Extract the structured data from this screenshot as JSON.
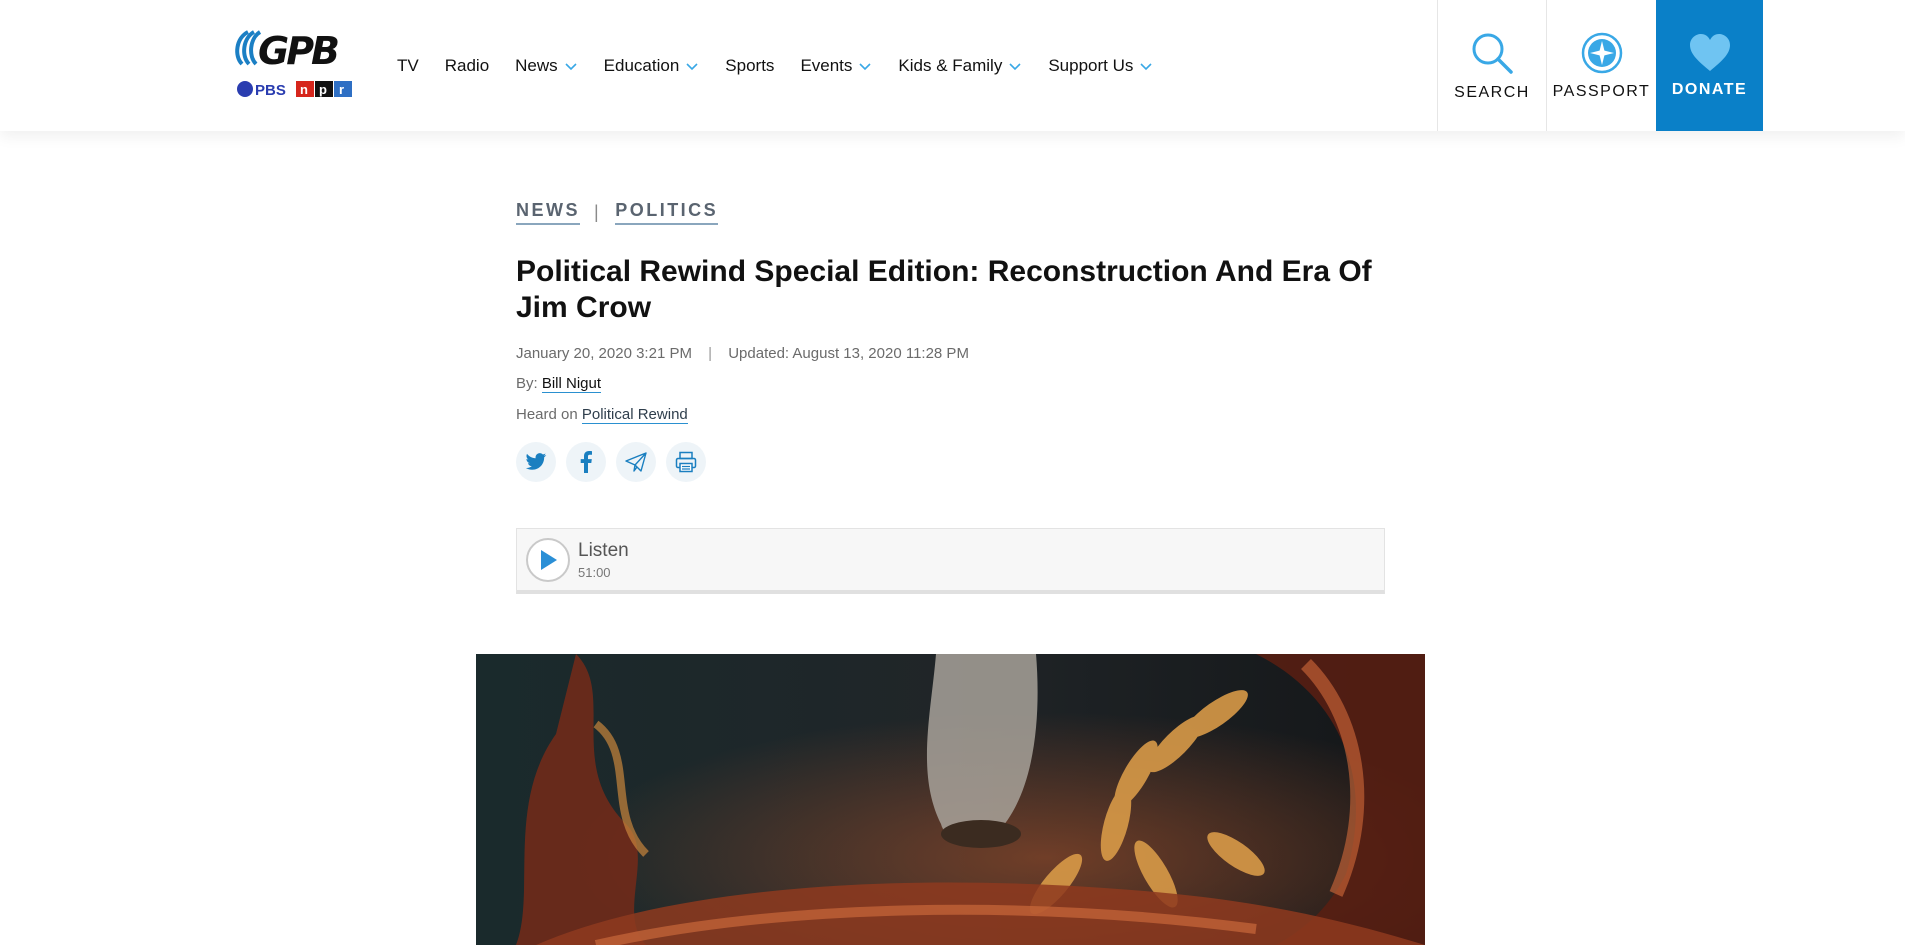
{
  "brand": {
    "name": "GPB",
    "partners": [
      "PBS",
      "npr"
    ],
    "accent": "#0a80c8"
  },
  "nav": {
    "items": [
      {
        "label": "TV",
        "dropdown": false
      },
      {
        "label": "Radio",
        "dropdown": false
      },
      {
        "label": "News",
        "dropdown": true
      },
      {
        "label": "Education",
        "dropdown": true
      },
      {
        "label": "Sports",
        "dropdown": false
      },
      {
        "label": "Events",
        "dropdown": true
      },
      {
        "label": "Kids & Family",
        "dropdown": true
      },
      {
        "label": "Support Us",
        "dropdown": true
      }
    ]
  },
  "utility": {
    "search_label": "SEARCH",
    "passport_label": "PASSPORT",
    "donate_label": "DONATE"
  },
  "article": {
    "breadcrumbs": [
      "NEWS",
      "POLITICS"
    ],
    "breadcrumb_separator": "|",
    "title": "Political Rewind Special Edition: Reconstruction And Era Of Jim Crow",
    "published": "January 20, 2020 3:21 PM",
    "meta_separator": "|",
    "updated": "Updated: August 13, 2020 11:28 PM",
    "byline_prefix": "By: ",
    "author": "Bill Nigut",
    "heard_prefix": "Heard on ",
    "program": "Political Rewind"
  },
  "share": {
    "icons": [
      "twitter-icon",
      "facebook-icon",
      "email-share-icon",
      "print-icon"
    ]
  },
  "player": {
    "listen_label": "Listen",
    "duration": "51:00"
  }
}
